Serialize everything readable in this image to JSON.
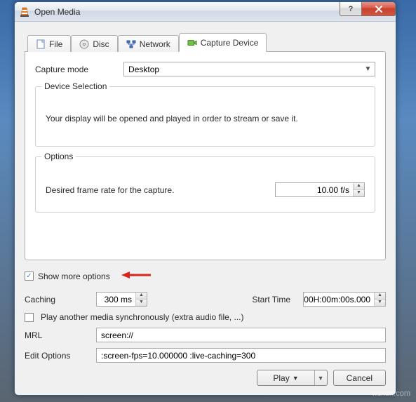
{
  "window": {
    "title": "Open Media"
  },
  "tabs": {
    "file": "File",
    "disc": "Disc",
    "network": "Network",
    "capture": "Capture Device"
  },
  "capture": {
    "mode_label": "Capture mode",
    "mode_value": "Desktop",
    "device_selection_title": "Device Selection",
    "device_selection_text": "Your display will be opened and played in order to stream or save it.",
    "options_title": "Options",
    "framerate_label": "Desired frame rate for the capture.",
    "framerate_value": "10.00 f/s"
  },
  "more_options": {
    "label": "Show more options",
    "checked": "✓"
  },
  "advanced": {
    "caching_label": "Caching",
    "caching_value": "300 ms",
    "start_time_label": "Start Time",
    "start_time_value": "00H:00m:00s.000",
    "play_another_label": "Play another media synchronously (extra audio file, ...)",
    "mrl_label": "MRL",
    "mrl_value": "screen://",
    "edit_options_label": "Edit Options",
    "edit_options_value": ":screen-fps=10.000000 :live-caching=300"
  },
  "buttons": {
    "play": "Play",
    "cancel": "Cancel"
  },
  "watermark": "wsxdn.com"
}
